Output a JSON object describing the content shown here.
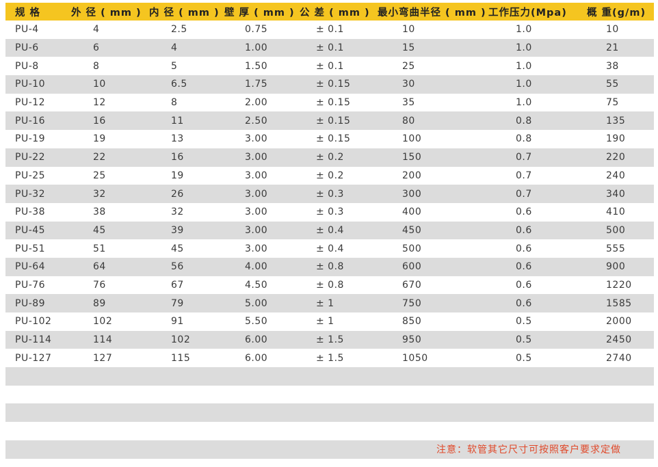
{
  "header": [
    "规 格",
    "外 径 ( mm )",
    "内 径 ( mm )",
    "壁 厚 ( mm )",
    "公 差 ( mm )",
    "最小弯曲半径 ( mm )",
    "工作压力(Mpa)",
    "概 重(g/m)"
  ],
  "rows": [
    [
      "PU-4",
      "4",
      "2.5",
      "0.75",
      "± 0.1",
      "10",
      "1.0",
      "10"
    ],
    [
      "PU-6",
      "6",
      "4",
      "1.00",
      "± 0.1",
      "15",
      "1.0",
      "21"
    ],
    [
      "PU-8",
      "8",
      "5",
      "1.50",
      "± 0.1",
      "25",
      "1.0",
      "38"
    ],
    [
      "PU-10",
      "10",
      "6.5",
      "1.75",
      "± 0.15",
      "30",
      "1.0",
      "55"
    ],
    [
      "PU-12",
      "12",
      "8",
      "2.00",
      "± 0.15",
      "35",
      "1.0",
      "75"
    ],
    [
      "PU-16",
      "16",
      "11",
      "2.50",
      "± 0.15",
      "80",
      "0.8",
      "135"
    ],
    [
      "PU-19",
      "19",
      "13",
      "3.00",
      "± 0.15",
      "100",
      "0.8",
      "190"
    ],
    [
      "PU-22",
      "22",
      "16",
      "3.00",
      "± 0.2",
      "150",
      "0.7",
      "220"
    ],
    [
      "PU-25",
      "25",
      "19",
      "3.00",
      "± 0.2",
      "200",
      "0.7",
      "240"
    ],
    [
      "PU-32",
      "32",
      "26",
      "3.00",
      "± 0.3",
      "300",
      "0.7",
      "340"
    ],
    [
      "PU-38",
      "38",
      "32",
      "3.00",
      "± 0.3",
      "400",
      "0.6",
      "410"
    ],
    [
      "PU-45",
      "45",
      "39",
      "3.00",
      "± 0.4",
      "450",
      "0.6",
      "500"
    ],
    [
      "PU-51",
      "51",
      "45",
      "3.00",
      "± 0.4",
      "500",
      "0.6",
      "555"
    ],
    [
      "PU-64",
      "64",
      "56",
      "4.00",
      "± 0.8",
      "600",
      "0.6",
      "900"
    ],
    [
      "PU-76",
      "76",
      "67",
      "4.50",
      "± 0.8",
      "670",
      "0.6",
      "1220"
    ],
    [
      "PU-89",
      "89",
      "79",
      "5.00",
      "± 1",
      "750",
      "0.6",
      "1585"
    ],
    [
      "PU-102",
      "102",
      "91",
      "5.50",
      "± 1",
      "850",
      "0.5",
      "2000"
    ],
    [
      "PU-114",
      "114",
      "102",
      "6.00",
      "± 1.5",
      "950",
      "0.5",
      "2450"
    ],
    [
      "PU-127",
      "127",
      "115",
      "6.00",
      "± 1.5",
      "1050",
      "0.5",
      "2740"
    ]
  ],
  "note": "注意：软管其它尺寸可按照客户要求定做",
  "colors": {
    "header_bg": "#f5c520",
    "stripe_bg": "#dcdcdc",
    "note_color": "#e0492a"
  }
}
